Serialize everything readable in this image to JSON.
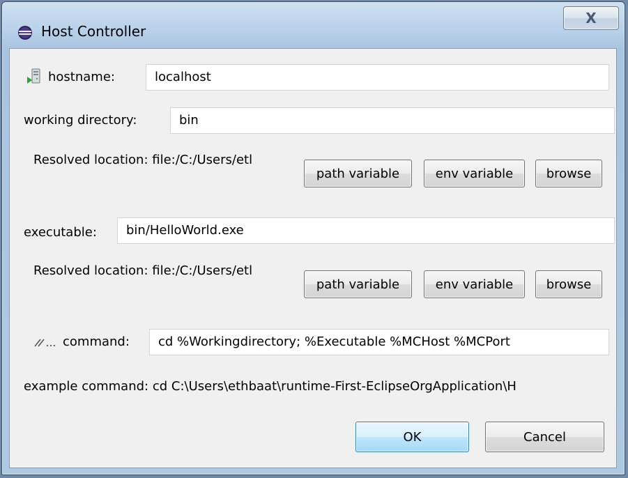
{
  "window": {
    "title": "Host Controller",
    "close_glyph": "X",
    "title_icon": "eclipse-icon"
  },
  "hostname": {
    "icon": "host-server-icon",
    "label": "hostname:",
    "value": "localhost"
  },
  "working_directory": {
    "label": "working directory:",
    "value": "bin",
    "resolved": "Resolved location: file:/C:/Users/etl",
    "path_variable": "path variable",
    "env_variable": "env variable",
    "browse": "browse"
  },
  "executable": {
    "label": "executable:",
    "value": "bin/HelloWorld.exe",
    "resolved": "Resolved location: file:/C:/Users/etl",
    "path_variable": "path variable",
    "env_variable": "env variable",
    "browse": "browse"
  },
  "command": {
    "icon": "command-line-icon",
    "label": "command:",
    "value": "cd %Workingdirectory; %Executable %MCHost %MCPort",
    "example": "example command: cd C:\\Users\\ethbaat\\runtime-First-EclipseOrgApplication\\H"
  },
  "buttons": {
    "ok": "OK",
    "cancel": "Cancel"
  }
}
